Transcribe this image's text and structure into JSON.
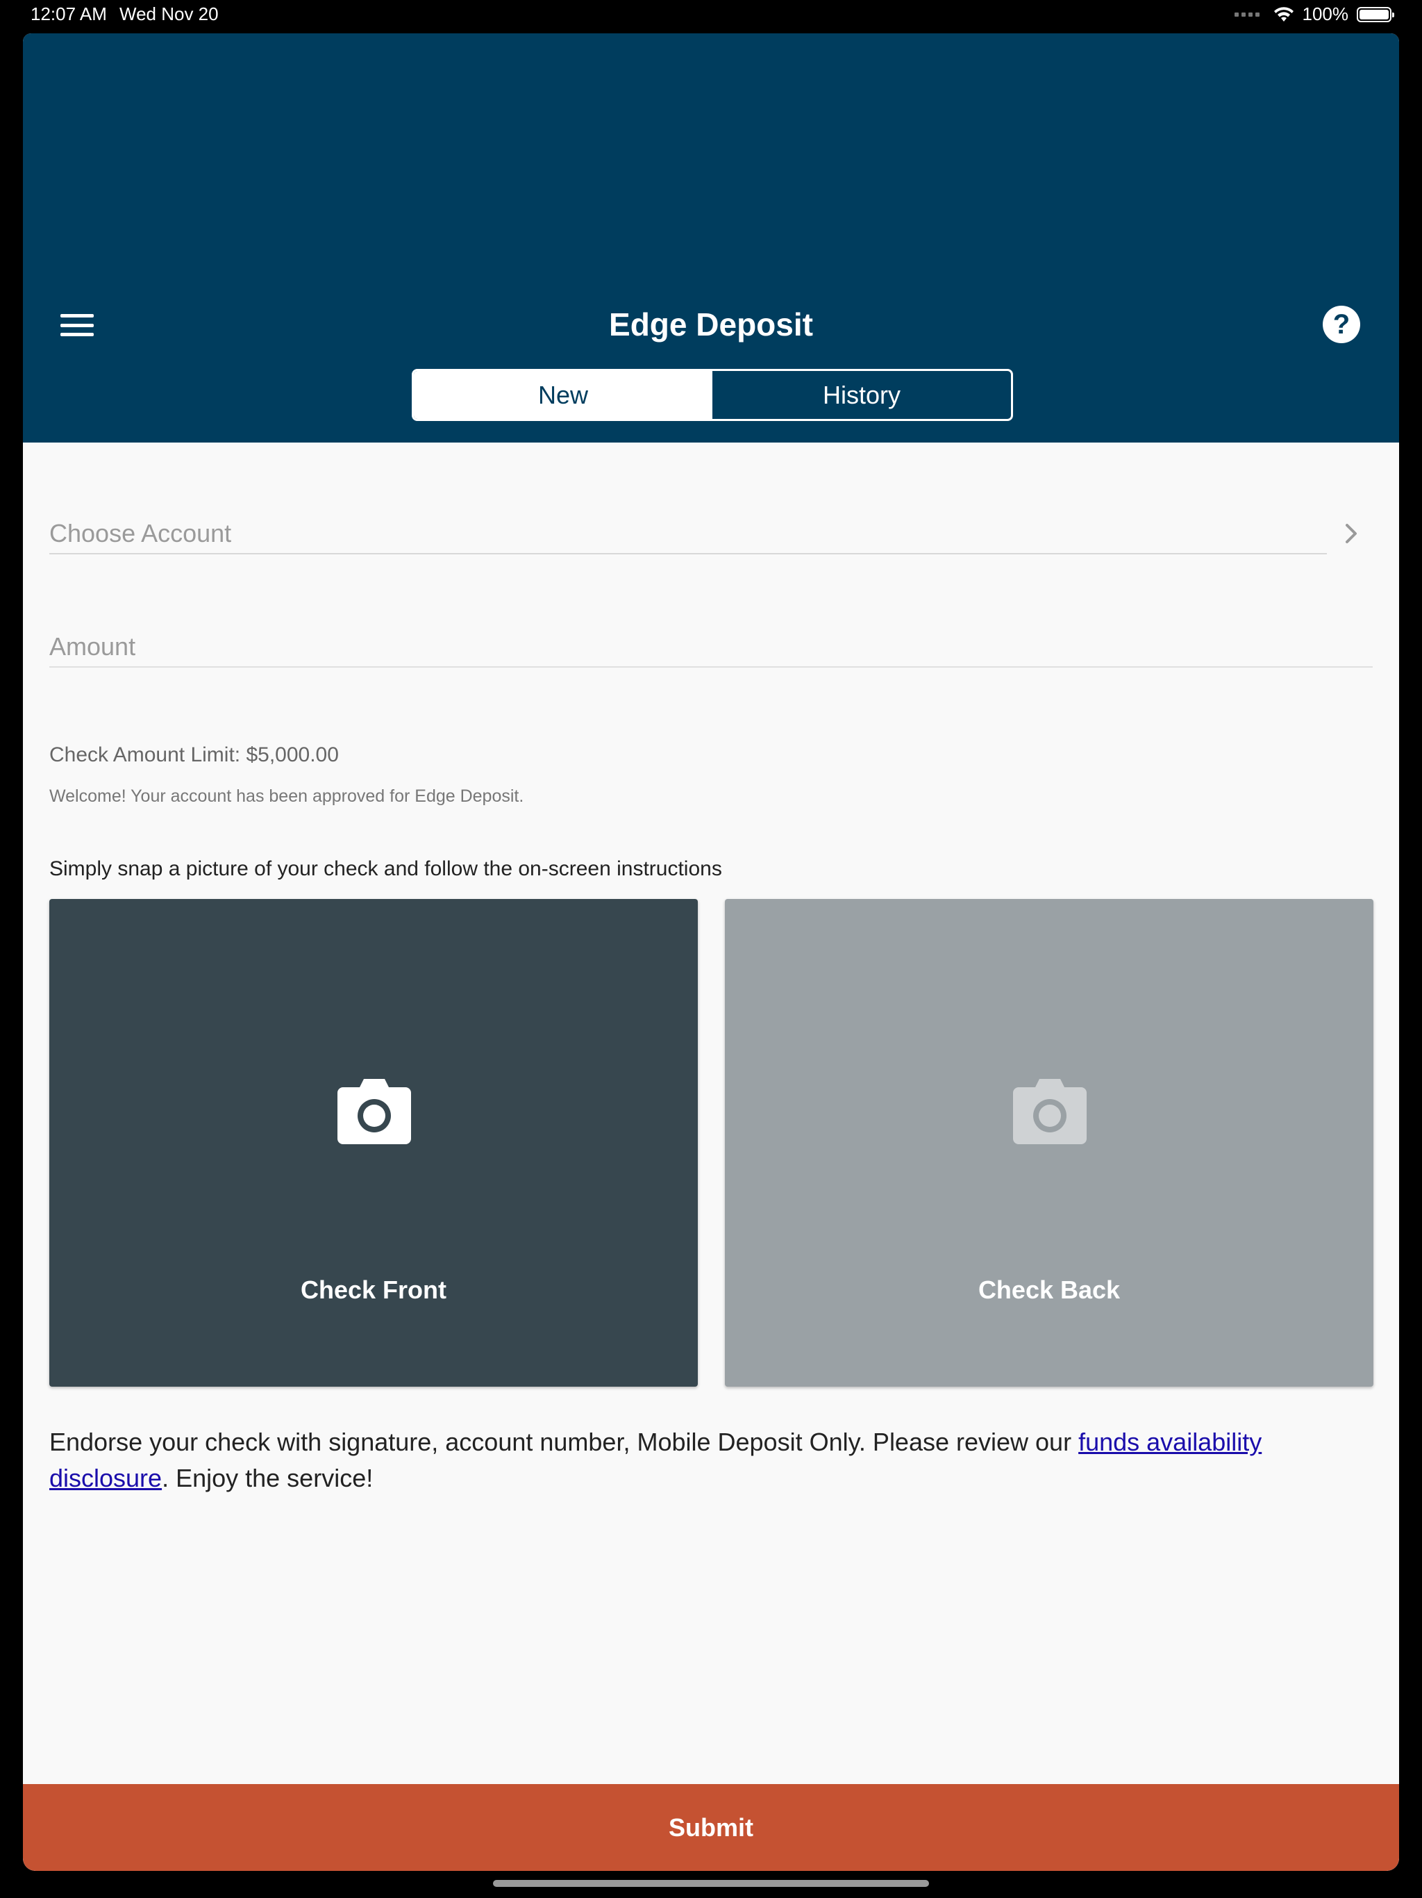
{
  "status_bar": {
    "time": "12:07 AM",
    "date": "Wed Nov 20",
    "battery": "100%",
    "battery_level": 1.0
  },
  "header": {
    "title": "Edge Deposit",
    "menu_icon": "hamburger-menu-icon",
    "help_icon": "question-circle-icon",
    "help_glyph": "?"
  },
  "tabs": [
    {
      "label": "New",
      "active": true
    },
    {
      "label": "History",
      "active": false
    }
  ],
  "form": {
    "choose_account_placeholder": "Choose Account",
    "amount_placeholder": "Amount",
    "amount_value": ""
  },
  "info": {
    "limit_text": "Check Amount Limit: $5,000.00",
    "welcome_text": "Welcome! Your account has been approved for Edge Deposit.",
    "instructions_text": "Simply snap a picture of your check and follow the on-screen instructions"
  },
  "photos": {
    "front_label": "Check Front",
    "back_label": "Check Back"
  },
  "endorse": {
    "text_before": "Endorse your check with signature, account number, Mobile Deposit Only. Please review our ",
    "link_text": "funds availability disclosure",
    "text_after": ". Enjoy the service!"
  },
  "submit_label": "Submit",
  "colors": {
    "header": "#003d5e",
    "submit": "#c55232",
    "front_tile": "#37474f",
    "back_tile": "#9aa1a5",
    "link": "#1a0dab"
  }
}
